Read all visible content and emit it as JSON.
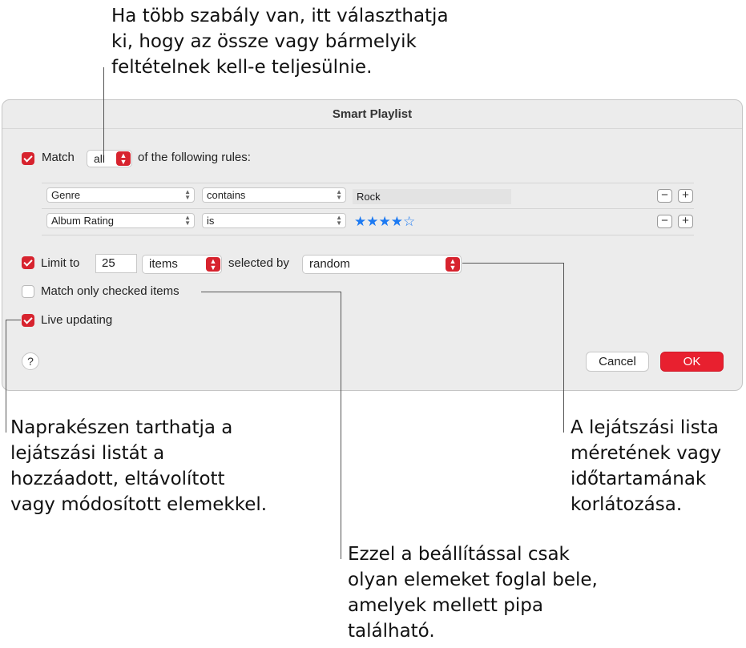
{
  "callouts": {
    "top": [
      "Ha több szabály van, itt választhatja",
      "ki, hogy az össze vagy bármelyik",
      "feltételnek kell-e teljesülnie."
    ],
    "left": [
      "Naprakészen tarthatja a",
      "lejátszási listát a",
      "hozzáadott, eltávolított",
      "vagy módosított elemekkel."
    ],
    "right": [
      "A lejátszási lista",
      "méretének vagy",
      "időtartamának",
      "korlátozása."
    ],
    "bottom": [
      "Ezzel a beállítással csak",
      "olyan elemeket foglal bele,",
      "amelyek mellett pipa",
      "található."
    ]
  },
  "dialog": {
    "title": "Smart Playlist",
    "match": {
      "checked": true,
      "label": "Match",
      "selector_value": "all",
      "suffix": "of the following rules:"
    },
    "rules": [
      {
        "field": "Genre",
        "operator": "contains",
        "value": "Rock"
      },
      {
        "field": "Album Rating",
        "operator": "is",
        "stars": "★★★★☆",
        "rating": 4,
        "rating_max": 5
      }
    ],
    "rule_buttons": {
      "remove": "−",
      "add": "+"
    },
    "limit": {
      "checked": true,
      "label": "Limit to",
      "value": "25",
      "unit": "items",
      "selected_by_label": "selected by",
      "selected_by_value": "random"
    },
    "match_checked": {
      "checked": false,
      "label": "Match only checked items"
    },
    "live_updating": {
      "checked": true,
      "label": "Live updating"
    },
    "help_label": "?",
    "cancel_label": "Cancel",
    "ok_label": "OK"
  },
  "colors": {
    "accent": "#d7232e",
    "star": "#1d7af2",
    "ok_button": "#e8202f"
  },
  "icons": {
    "popup_arrows": "up-down-chevron-icon"
  }
}
